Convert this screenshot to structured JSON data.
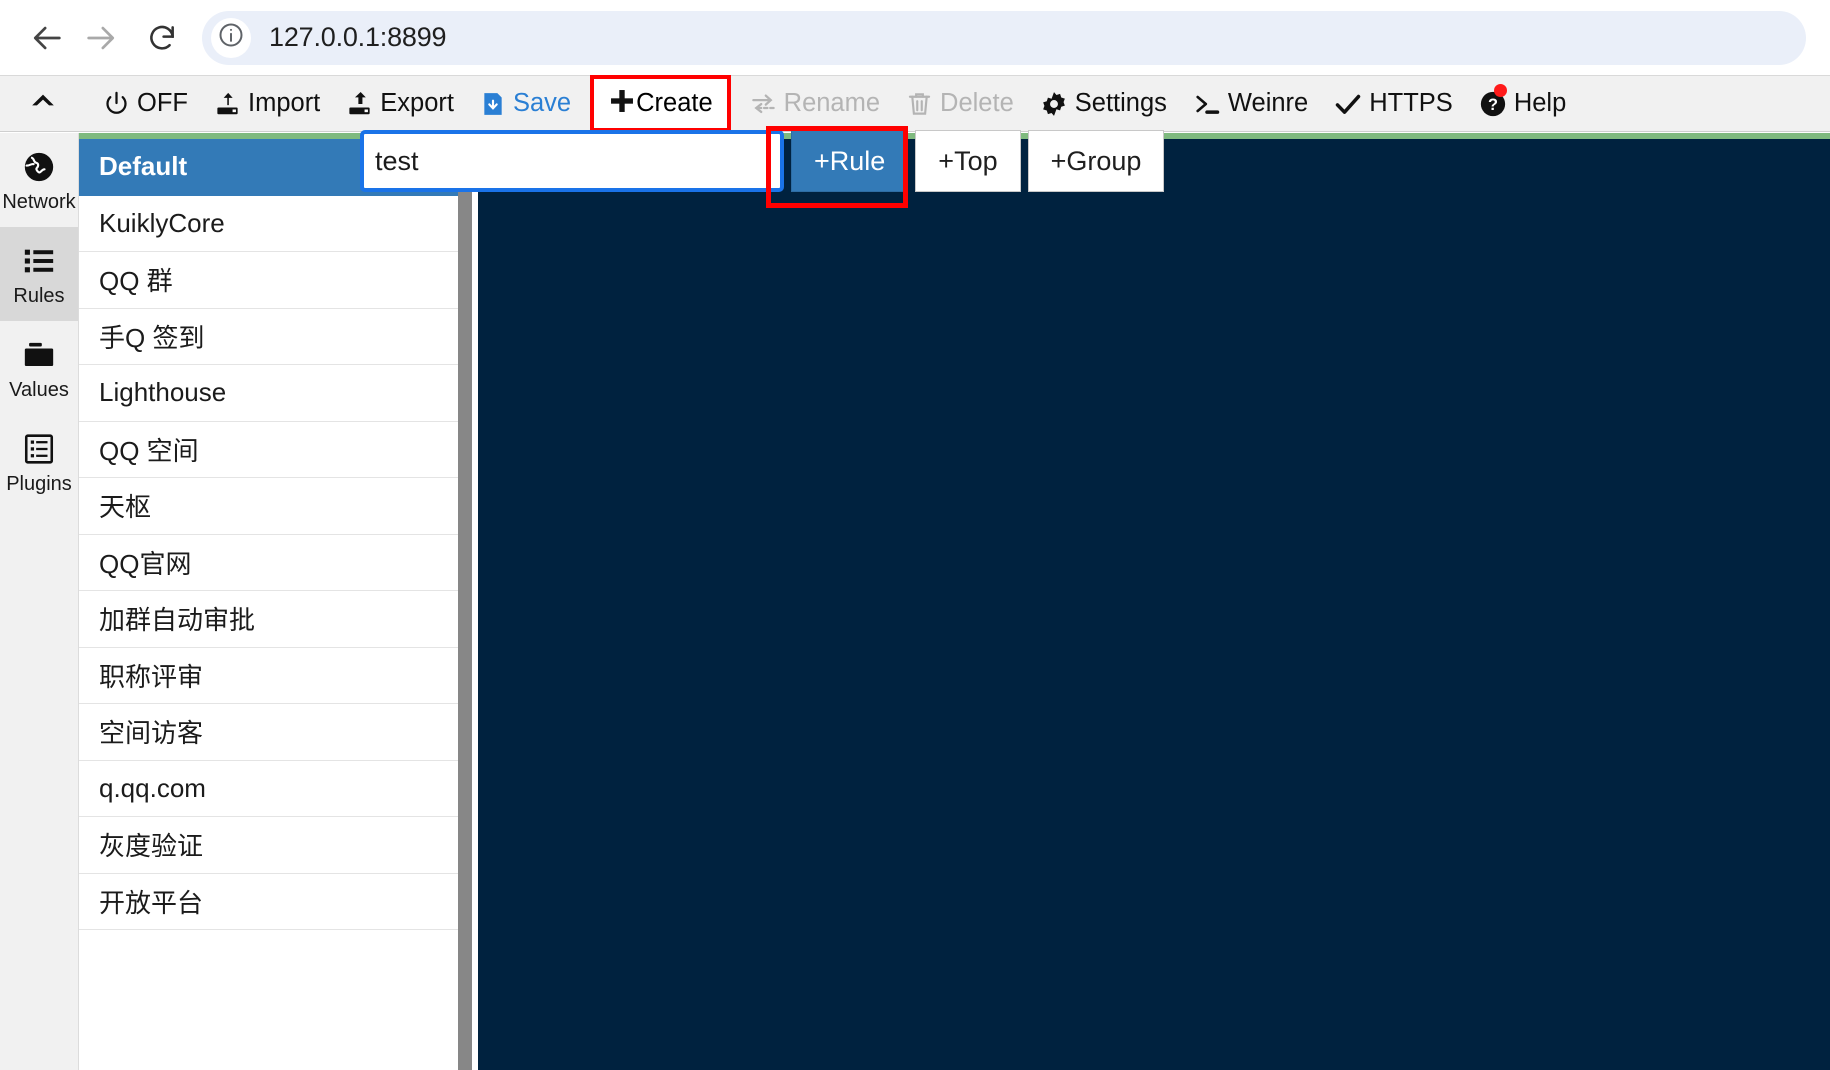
{
  "browser": {
    "back_icon": "arrow-left-icon",
    "forward_icon": "arrow-right-icon",
    "reload_icon": "reload-icon",
    "site_info_icon": "info-circle-icon",
    "url": "127.0.0.1:8899"
  },
  "toolbar": {
    "collapse_icon": "chevron-up-icon",
    "items": [
      {
        "label": "OFF",
        "icon": "power-icon",
        "state": "normal",
        "name": "toolbar-off"
      },
      {
        "label": "Import",
        "icon": "import-icon",
        "state": "normal",
        "name": "toolbar-import"
      },
      {
        "label": "Export",
        "icon": "export-icon",
        "state": "normal",
        "name": "toolbar-export"
      },
      {
        "label": "Save",
        "icon": "save-icon",
        "state": "accent",
        "name": "toolbar-save"
      },
      {
        "label": "Create",
        "icon": "plus-icon",
        "state": "normal",
        "name": "toolbar-create"
      },
      {
        "label": "Rename",
        "icon": "rename-icon",
        "state": "disabled",
        "name": "toolbar-rename"
      },
      {
        "label": "Delete",
        "icon": "trash-icon",
        "state": "disabled",
        "name": "toolbar-delete"
      },
      {
        "label": "Settings",
        "icon": "gear-icon",
        "state": "normal",
        "name": "toolbar-settings"
      },
      {
        "label": "Weinre",
        "icon": "terminal-icon",
        "state": "normal",
        "name": "toolbar-weinre"
      },
      {
        "label": "HTTPS",
        "icon": "check-icon",
        "state": "normal",
        "name": "toolbar-https"
      },
      {
        "label": "Help",
        "icon": "help-icon",
        "state": "normal",
        "name": "toolbar-help"
      }
    ]
  },
  "rail": {
    "items": [
      {
        "label": "Network",
        "icon": "globe-icon",
        "active": false
      },
      {
        "label": "Rules",
        "icon": "list-icon",
        "active": true
      },
      {
        "label": "Values",
        "icon": "folder-icon",
        "active": false
      },
      {
        "label": "Plugins",
        "icon": "plugins-icon",
        "active": false
      }
    ]
  },
  "create_bar": {
    "input_value": "test",
    "input_placeholder": "",
    "buttons": [
      {
        "label": "+Rule",
        "primary": true
      },
      {
        "label": "+Top",
        "primary": false
      },
      {
        "label": "+Group",
        "primary": false
      }
    ]
  },
  "rules_list": {
    "items": [
      {
        "label": "Default",
        "selected": true
      },
      {
        "label": "KuiklyCore",
        "selected": false
      },
      {
        "label": "QQ 群",
        "selected": false
      },
      {
        "label": "手Q 签到",
        "selected": false
      },
      {
        "label": "Lighthouse",
        "selected": false
      },
      {
        "label": "QQ 空间",
        "selected": false
      },
      {
        "label": "天枢",
        "selected": false
      },
      {
        "label": "QQ官网",
        "selected": false
      },
      {
        "label": "加群自动审批",
        "selected": false
      },
      {
        "label": "职称评审",
        "selected": false
      },
      {
        "label": "空间访客",
        "selected": false
      },
      {
        "label": "q.qq.com",
        "selected": false
      },
      {
        "label": "灰度验证",
        "selected": false
      },
      {
        "label": "开放平台",
        "selected": false
      }
    ]
  },
  "colors": {
    "selected_row": "#337ab7",
    "editor_background": "#00223f",
    "accent_bar": "#7fba7f",
    "highlight_box": "#ff0000",
    "focus_ring": "#1a73e8",
    "save_text": "#2a7fd4"
  }
}
